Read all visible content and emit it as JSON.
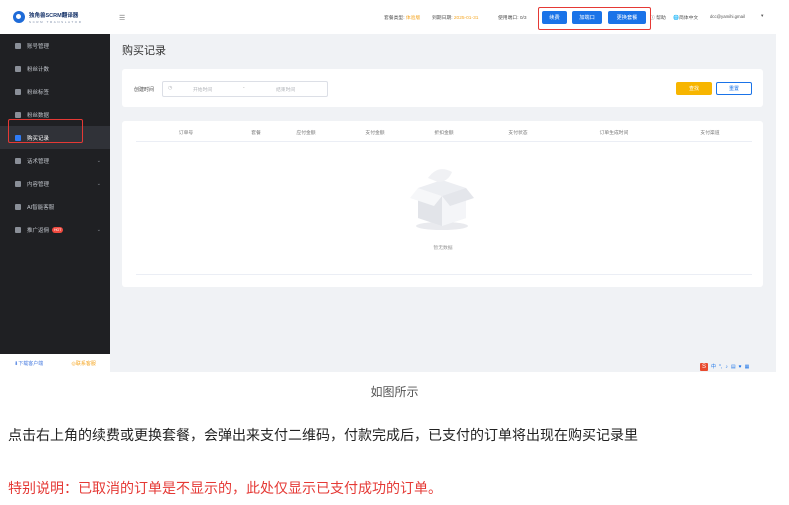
{
  "app": {
    "logo_title": "独角兽SCRM翻译器",
    "logo_sub": "SCRM TRANSLATOR"
  },
  "sidebar": {
    "items": [
      {
        "label": "账号管理"
      },
      {
        "label": "粉丝计数"
      },
      {
        "label": "粉丝标签"
      },
      {
        "label": "粉丝数据"
      },
      {
        "label": "购买记录"
      },
      {
        "label": "话术管理"
      },
      {
        "label": "内容管理"
      },
      {
        "label": "AI智能客服"
      },
      {
        "label": "推广返佣",
        "badge": "HOT"
      }
    ],
    "footer": {
      "download": "下载客户端",
      "service": "联系客服"
    }
  },
  "topbar": {
    "plan_label": "套餐类型:",
    "plan_value": "体验版",
    "expire_label": "到期日期:",
    "expire_value": "2025-01-31",
    "ports_label": "使用端口:",
    "ports_value": "0/3",
    "renew_button": "续费",
    "add_port_button": "加端口",
    "change_plan_button": "更换套餐",
    "help": "帮助",
    "language": "简体中文",
    "email": "dcc@yamihi.gmail"
  },
  "page": {
    "title": "购买记录",
    "filter_label": "创建时间",
    "start_placeholder": "开始时间",
    "end_placeholder": "结束时间",
    "search_button": "查找",
    "reset_button": "重置",
    "columns": [
      "订单号",
      "套餐",
      "应付金额",
      "支付金额",
      "折扣金额",
      "支付状态",
      "订单生成时间",
      "支付渠道"
    ],
    "empty_text": "暂无数据"
  },
  "caption": "如图所示",
  "description": "点击右上角的续费或更换套餐，会弹出来支付二维码，付款完成后，已支付的订单将出现在购买记录里",
  "note": "特别说明：已取消的订单是不显示的，此处仅显示已支付成功的订单。"
}
